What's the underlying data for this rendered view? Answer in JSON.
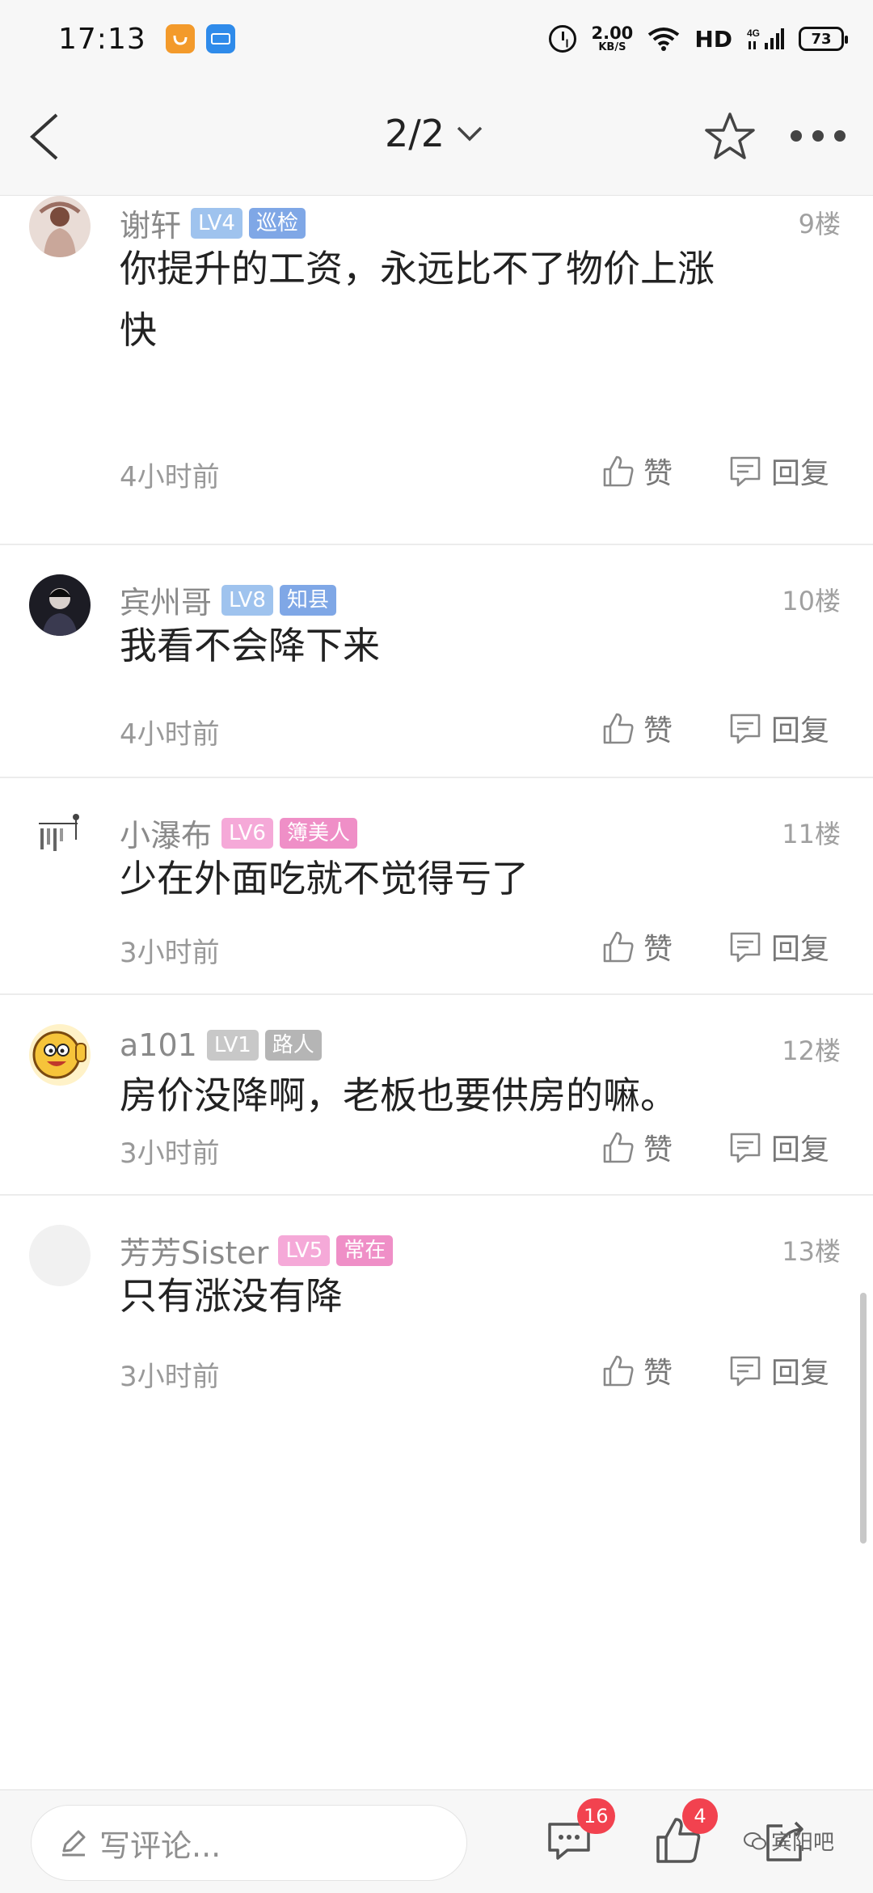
{
  "status_bar": {
    "time": "17:13",
    "net_speed_value": "2.00",
    "net_speed_unit": "KB/S",
    "hd": "HD",
    "network": "4G",
    "battery": "73"
  },
  "nav": {
    "page_indicator": "2/2"
  },
  "comments": [
    {
      "username": "谢轩",
      "level": "LV4",
      "title": "巡检",
      "floor": "9楼",
      "content_lines": [
        "你提升的工资，永远比不了物价上涨",
        "快"
      ],
      "time": "4小时前",
      "like": "赞",
      "reply": "回复"
    },
    {
      "username": "宾州哥",
      "level": "LV8",
      "title": "知县",
      "floor": "10楼",
      "content_lines": [
        "我看不会降下来"
      ],
      "time": "4小时前",
      "like": "赞",
      "reply": "回复"
    },
    {
      "username": "小瀑布",
      "level": "LV6",
      "title": "簿美人",
      "floor": "11楼",
      "content_lines": [
        "少在外面吃就不觉得亏了"
      ],
      "time": "3小时前",
      "like": "赞",
      "reply": "回复"
    },
    {
      "username": "a101",
      "level": "LV1",
      "title": "路人",
      "floor": "12楼",
      "content_lines": [
        "房价没降啊，老板也要供房的嘛。"
      ],
      "time": "3小时前",
      "like": "赞",
      "reply": "回复"
    },
    {
      "username": "芳芳Sister",
      "level": "LV5",
      "title": "常在",
      "floor": "13楼",
      "content_lines": [
        "只有涨没有降"
      ],
      "time": "3小时前",
      "like": "赞",
      "reply": "回复"
    }
  ],
  "bottom_bar": {
    "comment_placeholder": "写评论...",
    "comment_count": "16",
    "like_count": "4",
    "watermark": "宾阳吧"
  },
  "colors": {
    "blue_badge": "#9fc3ee",
    "blue_title": "#7fa7e6",
    "pink_badge": "#f5a9d8",
    "pink_title": "#ef8fc7",
    "gray_badge": "#c8c8c8",
    "red_badge": "#f2424f"
  }
}
